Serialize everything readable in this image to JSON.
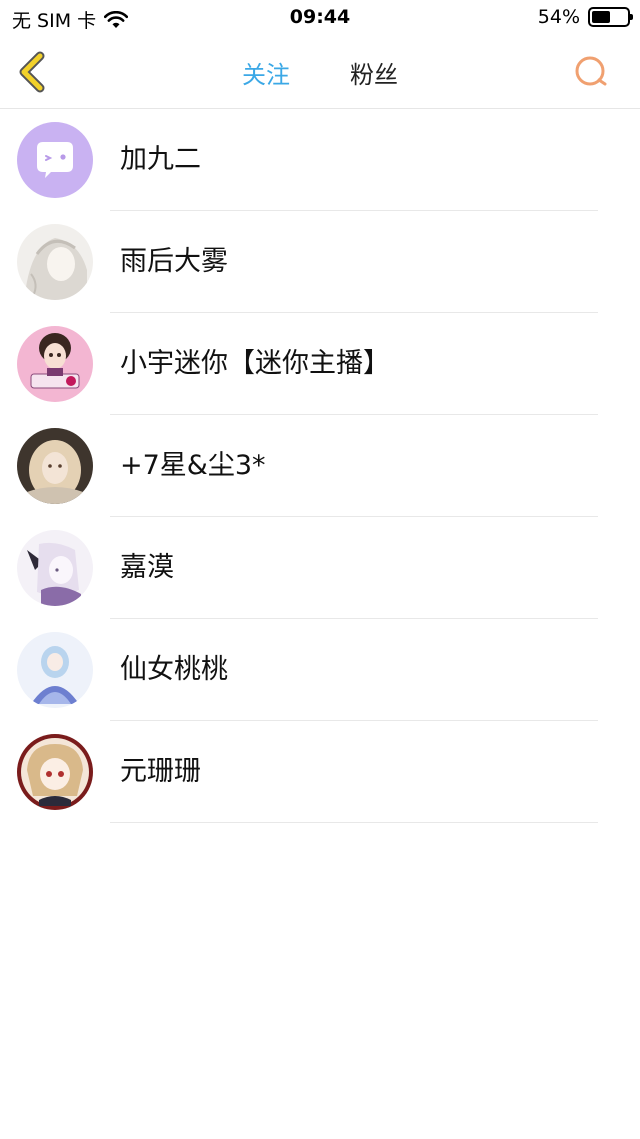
{
  "status_bar": {
    "carrier": "无 SIM 卡",
    "time": "09:44",
    "battery_percent": "54%",
    "battery_level": 0.54
  },
  "nav": {
    "tabs": [
      {
        "label": "关注",
        "active": true
      },
      {
        "label": "粉丝",
        "active": false
      }
    ],
    "back_icon": "chevron-left-icon",
    "search_icon": "search-icon",
    "accent_color": "#3ba8e6",
    "back_color": "#e6c200",
    "search_color": "#f0a070"
  },
  "users": [
    {
      "name": "加九二"
    },
    {
      "name": "雨后大雾"
    },
    {
      "name": "小宇迷你【迷你主播】"
    },
    {
      "name": "+7星&尘3*"
    },
    {
      "name": "嘉漠"
    },
    {
      "name": "仙女桃桃"
    },
    {
      "name": "元珊珊"
    }
  ]
}
